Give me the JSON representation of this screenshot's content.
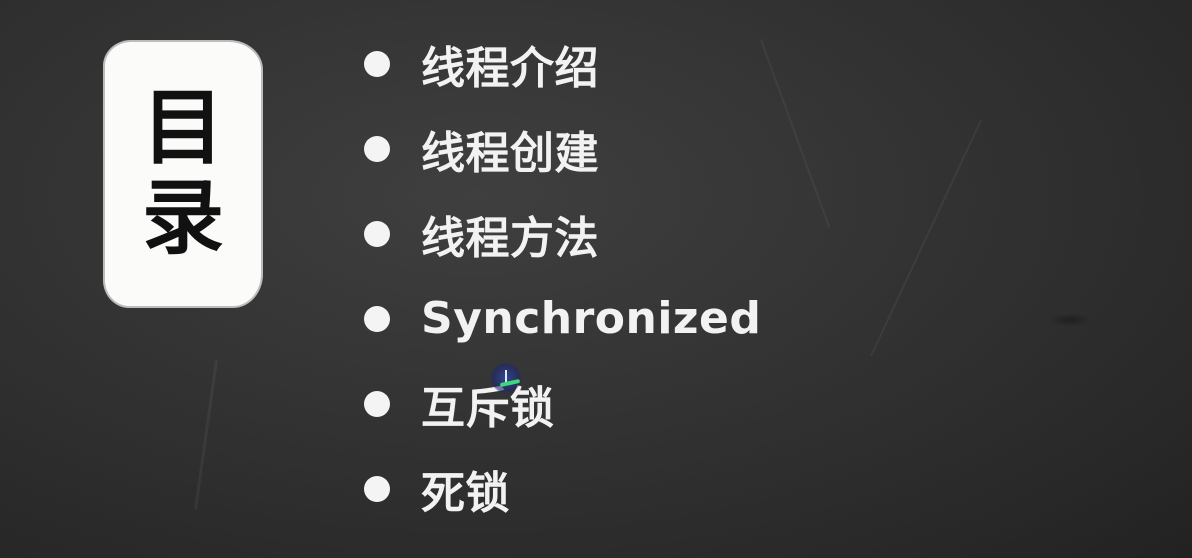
{
  "slide": {
    "title_chars": [
      "目",
      "录"
    ],
    "agenda": [
      {
        "label": "线程介绍"
      },
      {
        "label": "线程创建"
      },
      {
        "label": "线程方法"
      },
      {
        "label": "Synchronized"
      },
      {
        "label": "互斥锁"
      },
      {
        "label": "死锁"
      }
    ]
  },
  "colors": {
    "background": "#333333",
    "card": "#fbfbf9",
    "text": "#f2f2f2",
    "title_text": "#111111",
    "cursor_highlight": "#3fd77a"
  },
  "icons": {
    "bullet": "filled-circle",
    "cursor": "text-cursor-icon"
  }
}
